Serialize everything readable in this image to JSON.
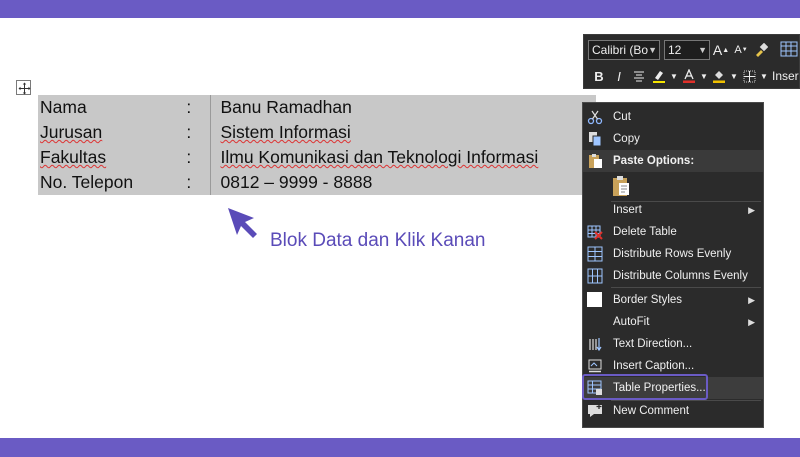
{
  "colors": {
    "accent": "#6a5bc4",
    "menu_bg": "#2b2b2b",
    "table_bg": "#c8c8c8"
  },
  "table": {
    "rows": [
      {
        "label": "Nama",
        "colon": ":",
        "value": "Banu Ramadhan"
      },
      {
        "label": "Jurusan",
        "colon": ":",
        "value": "Sistem Informasi"
      },
      {
        "label": "Fakultas",
        "colon": ":",
        "value": "Ilmu Komunikasi dan Teknologi Informasi"
      },
      {
        "label": "No. Telepon",
        "colon": ":",
        "value": "0812 – 9999 - 8888"
      }
    ]
  },
  "callout": {
    "text": "Blok Data dan Klik Kanan"
  },
  "mini_toolbar": {
    "font": "Calibri (Bo",
    "size": "12",
    "bold": "B",
    "italic": "I",
    "insert": "Inser",
    "grow": "A",
    "shrink": "A"
  },
  "context_menu": {
    "cut": "Cut",
    "copy": "Copy",
    "paste_options": "Paste Options:",
    "insert": "Insert",
    "delete_table": "Delete Table",
    "distribute_rows": "Distribute Rows Evenly",
    "distribute_columns": "Distribute Columns Evenly",
    "border_styles": "Border Styles",
    "autofit": "AutoFit",
    "text_direction": "Text Direction...",
    "insert_caption": "Insert Caption...",
    "table_properties": "Table Properties...",
    "new_comment": "New Comment"
  }
}
